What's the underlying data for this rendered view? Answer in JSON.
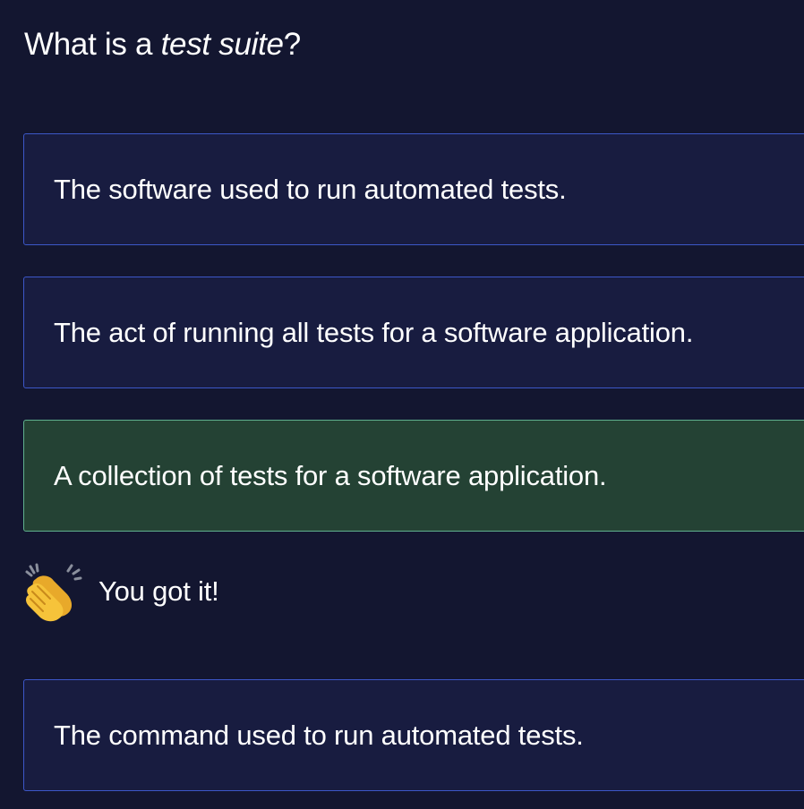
{
  "question": {
    "prefix": "What is a ",
    "emphasis": "test suite",
    "suffix": "?"
  },
  "options": [
    {
      "label": "The software used to run automated tests.",
      "state": "default"
    },
    {
      "label": "The act of running all tests for a software application.",
      "state": "default"
    },
    {
      "label": "A collection of tests for a software application.",
      "state": "correct"
    },
    {
      "label": "The command used to run automated tests.",
      "state": "default"
    }
  ],
  "feedback": {
    "icon": "clapping-hands-icon",
    "message": "You got it!"
  },
  "colors": {
    "background": "#131630",
    "option_background": "#181c40",
    "option_border": "#3c57c8",
    "correct_background": "#244234",
    "correct_border": "#5fb08d"
  }
}
